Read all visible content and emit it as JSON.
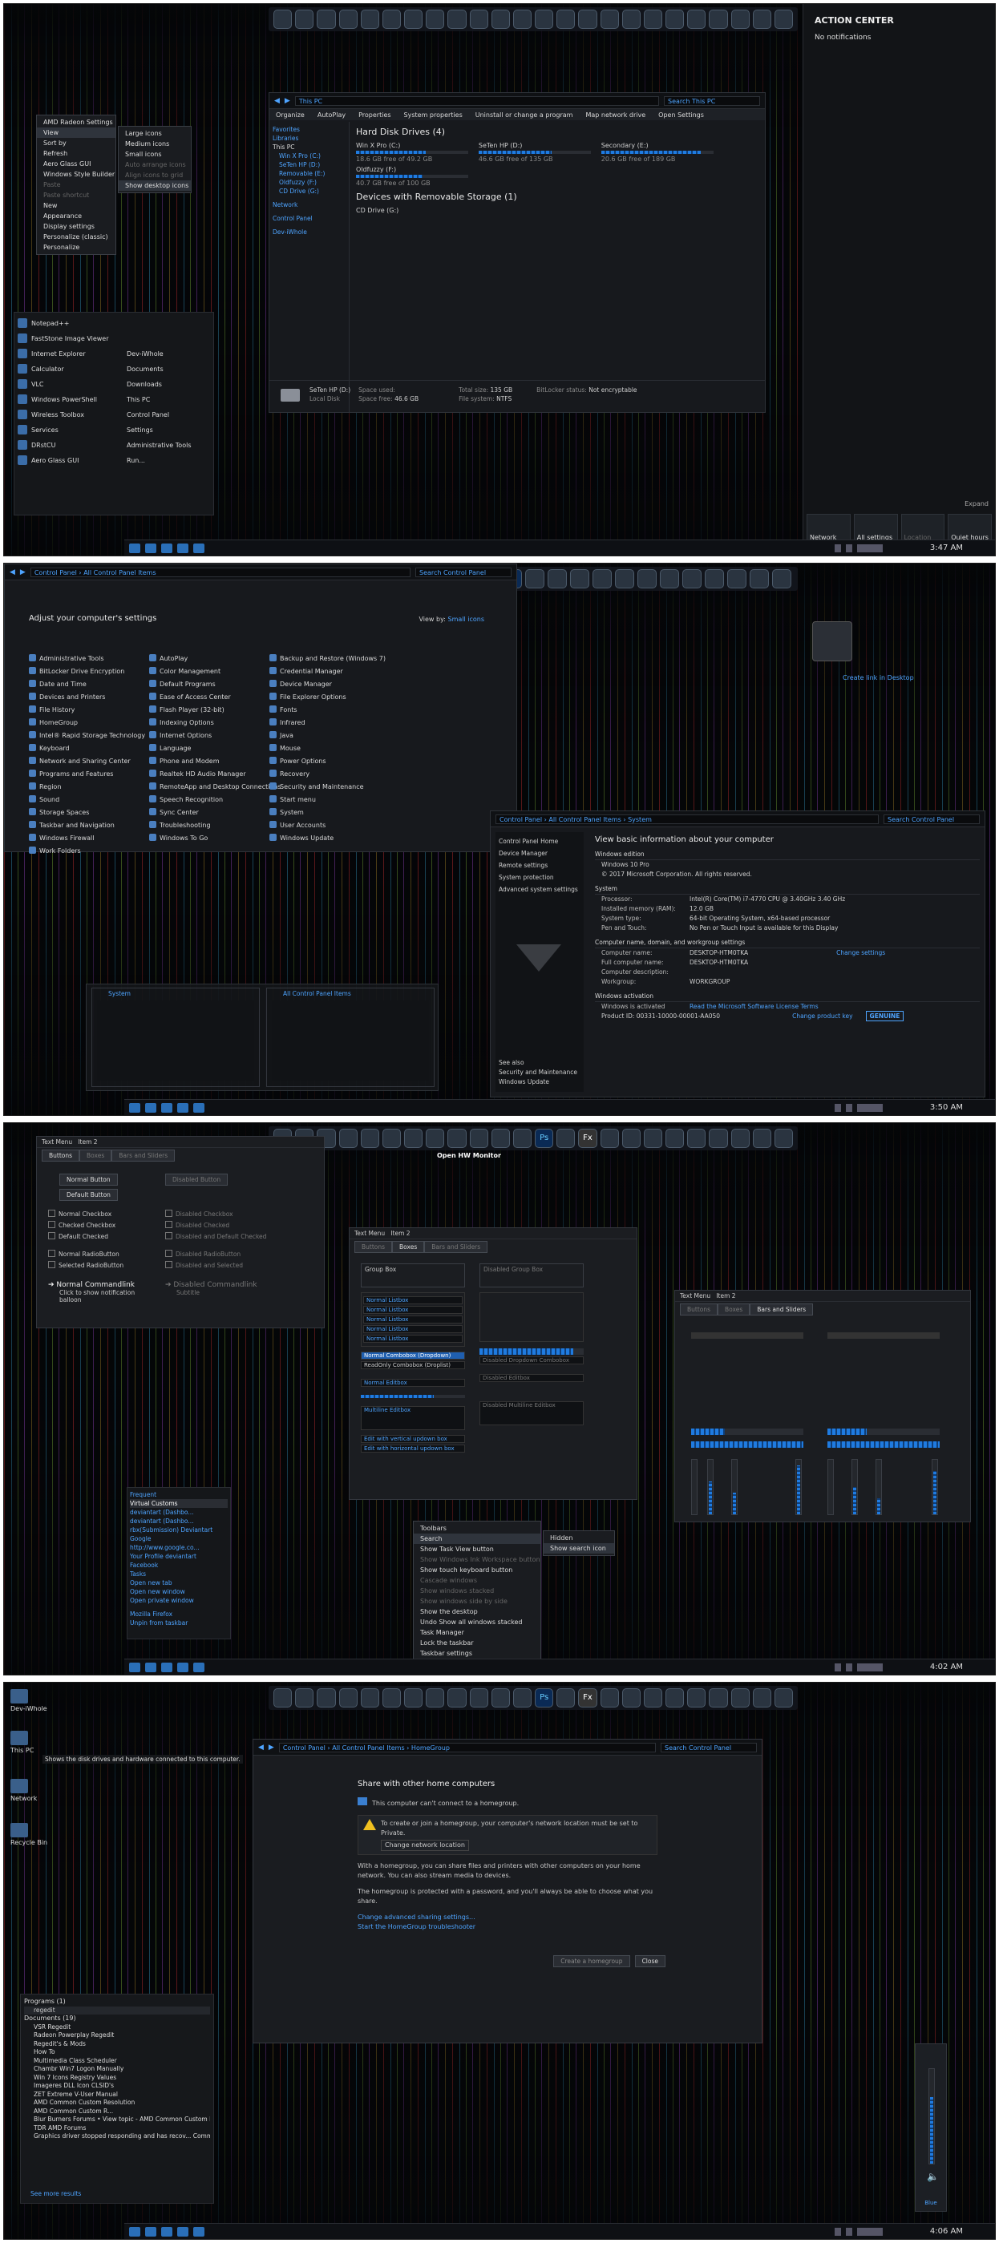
{
  "s1": {
    "menu": {
      "title": "AMD Radeon Settings",
      "items": [
        "View",
        "Sort by",
        "Refresh",
        "Aero Glass GUI",
        "Windows Style Builder",
        "Paste",
        "Paste shortcut",
        "New",
        "Appearance",
        "Display settings",
        "Personalize (classic)",
        "Personalize"
      ]
    },
    "viewmenu": [
      "Large icons",
      "Medium icons",
      "Small icons",
      "Auto arrange icons",
      "Align icons to grid",
      "Show desktop icons"
    ],
    "explorer": {
      "breadcrumb": "This PC",
      "search": "Search This PC",
      "cmds": [
        "Organize",
        "AutoPlay",
        "Properties",
        "System properties",
        "Uninstall or change a program",
        "Map network drive",
        "Open Settings"
      ],
      "side": [
        "Favorites",
        "Libraries",
        "This PC",
        "Win X Pro (C:)",
        "SeTen HP (D:)",
        "Removable (E:)",
        "Oldfuzzy (F:)",
        "CD Drive (G:)",
        "Network",
        "Control Panel",
        "Dev-iWhole"
      ],
      "hdd_title": "Hard Disk Drives (4)",
      "drives": [
        {
          "name": "Win X Pro (C:)",
          "free": "18.6 GB free of 49.2 GB",
          "pct": 62
        },
        {
          "name": "SeTen HP (D:)",
          "free": "46.6 GB free of 135 GB",
          "pct": 65
        },
        {
          "name": "Secondary (E:)",
          "free": "20.6 GB free of 189 GB",
          "pct": 89
        },
        {
          "name": "Oldfuzzy (F:)",
          "free": "40.7 GB free of 100 GB",
          "pct": 59
        }
      ],
      "rem_title": "Devices with Removable Storage (1)",
      "cd": "CD Drive (G:)",
      "status_name": "SeTen HP (D:)",
      "status_type": "Local Disk",
      "space_used_lbl": "Space used:",
      "space_free_lbl": "Space free:",
      "space_free": "46.6 GB",
      "total_lbl": "Total size:",
      "total": "135 GB",
      "fs_lbl": "File system:",
      "fs": "NTFS",
      "bl_lbl": "BitLocker status:",
      "bl": "Not encryptable"
    },
    "start": {
      "left": [
        "Notepad++",
        "FastStone Image Viewer",
        "Internet Explorer",
        "Calculator",
        "VLC",
        "Windows PowerShell",
        "Wireless Toolbox",
        "Services",
        "DRstCU",
        "Aero Glass GUI"
      ],
      "right": [
        "Dev-iWhole",
        "Documents",
        "Downloads",
        "This PC",
        "Control Panel",
        "Settings",
        "Administrative Tools",
        "Run..."
      ]
    },
    "ac": {
      "title": "ACTION CENTER",
      "none": "No notifications",
      "expand": "Expand",
      "btns": [
        "Network",
        "All settings",
        "Location",
        "Quiet hours"
      ]
    },
    "clock": "3:47 AM"
  },
  "s2": {
    "bc": [
      "Control Panel",
      "All Control Panel Items"
    ],
    "search": "Search Control Panel",
    "heading": "Adjust your computer's settings",
    "viewby_lbl": "View by:",
    "viewby": "Small icons",
    "items": [
      "Administrative Tools",
      "AutoPlay",
      "Backup and Restore (Windows 7)",
      "BitLocker Drive Encryption",
      "Color Management",
      "Credential Manager",
      "Date and Time",
      "Default Programs",
      "Device Manager",
      "Devices and Printers",
      "Ease of Access Center",
      "File Explorer Options",
      "File History",
      "Flash Player (32-bit)",
      "Fonts",
      "HomeGroup",
      "Indexing Options",
      "Infrared",
      "Intel® Rapid Storage Technology",
      "Internet Options",
      "Java",
      "Keyboard",
      "Language",
      "Mouse",
      "Network and Sharing Center",
      "Phone and Modem",
      "Power Options",
      "Programs and Features",
      "Realtek HD Audio Manager",
      "Recovery",
      "Region",
      "RemoteApp and Desktop Connections",
      "Security and Maintenance",
      "Sound",
      "Speech Recognition",
      "Start menu",
      "Storage Spaces",
      "Sync Center",
      "System",
      "Taskbar and Navigation",
      "Troubleshooting",
      "User Accounts",
      "Windows Firewall",
      "Windows To Go",
      "Windows Update",
      "Work Folders"
    ],
    "shortcut": "Create link in Desktop",
    "sys": {
      "bc": [
        "Control Panel",
        "All Control Panel Items",
        "System"
      ],
      "search": "Search Control Panel",
      "side": [
        "Control Panel Home",
        "Device Manager",
        "Remote settings",
        "System protection",
        "Advanced system settings"
      ],
      "seealso": [
        "See also",
        "Security and Maintenance",
        "Windows Update"
      ],
      "title": "View basic information about your computer",
      "edition_h": "Windows edition",
      "edition": "Windows 10 Pro",
      "copyright": "© 2017 Microsoft Corporation. All rights reserved.",
      "system_h": "System",
      "rows": [
        [
          "Processor:",
          "Intel(R) Core(TM) i7-4770 CPU @ 3.40GHz   3.40 GHz"
        ],
        [
          "Installed memory (RAM):",
          "12.0 GB"
        ],
        [
          "System type:",
          "64-bit Operating System, x64-based processor"
        ],
        [
          "Pen and Touch:",
          "No Pen or Touch Input is available for this Display"
        ]
      ],
      "name_h": "Computer name, domain, and workgroup settings",
      "rows2": [
        [
          "Computer name:",
          "DESKTOP-HTM0TKA"
        ],
        [
          "Full computer name:",
          "DESKTOP-HTM0TKA"
        ],
        [
          "Computer description:",
          ""
        ],
        [
          "Workgroup:",
          "WORKGROUP"
        ]
      ],
      "change": "Change settings",
      "act_h": "Windows activation",
      "act": "Windows is activated",
      "lic": "Read the Microsoft Software License Terms",
      "pid": "Product ID: 00331-10000-00001-AA050",
      "pkey": "Change product key",
      "genuine": "GENUINE"
    },
    "thumbs": [
      "System",
      "All Control Panel Items"
    ],
    "clock": "3:50 AM"
  },
  "s3": {
    "title": "Open HW Monitor",
    "cp1": {
      "tabs": [
        "Text Menu",
        "Item 2"
      ],
      "subtabs": [
        "Buttons",
        "Boxes",
        "Bars and Sliders"
      ],
      "btns": [
        "Normal Button",
        "Disabled Button",
        "Default Button"
      ],
      "checks": [
        "Normal Checkbox",
        "Checked Checkbox",
        "Default Checked",
        "Disabled Checkbox",
        "Disabled Checked",
        "Disabled and Default Checked"
      ],
      "radios": [
        "Normal RadioButton",
        "Selected RadioButton",
        "Disabled RadioButton",
        "Disabled and Selected"
      ],
      "cl_title": "Normal Commandlink",
      "cl_sub": "Click to show notification balloon",
      "cl_dis": "Disabled Commandlink",
      "cl_dis_sub": "Subtitle"
    },
    "cp2": {
      "tabs": [
        "Text Menu",
        "Item 2"
      ],
      "subtabs": [
        "Buttons",
        "Boxes",
        "Bars and Sliders"
      ],
      "g1": "Group Box",
      "g2": "Disabled Group Box",
      "lines": [
        "Normal Listbox",
        "Normal Listbox",
        "Normal Listbox",
        "Normal Listbox",
        "Normal Listbox"
      ],
      "combo": "Normal Combobox (Dropdown)",
      "combo2": "ReadOnly Combobox (Droplist)",
      "combo3": "Disabled Dropdown Combobox",
      "edit": "Normal Editbox",
      "edit2": "Disabled Editbox",
      "multi": "Multiline Editbox",
      "multi2": "Disabled Multiline Editbox",
      "spin1": "Edit with vertical updown box",
      "spin2": "Edit with horizontal updown box"
    },
    "cp3": {
      "tabs": [
        "Text Menu",
        "Item 2"
      ],
      "subtabs": [
        "Buttons",
        "Boxes",
        "Bars and Sliders"
      ]
    },
    "jump": {
      "frequent_h": "Frequent",
      "pin": "Virtual Customs",
      "items": [
        "deviantart (Dashbo...",
        "deviantart (Dashbo...",
        "rbx(Submission) Deviantart",
        "Google",
        "http://www.google.co...",
        "Your Profile deviantart",
        "Facebook"
      ],
      "tasks_h": "Tasks",
      "tasks": [
        "Open new tab",
        "Open new window",
        "Open private window"
      ],
      "app": "Mozilla Firefox",
      "unpin": "Unpin from taskbar"
    },
    "tbmenu": [
      "Toolbars",
      "Search",
      "Show Task View button",
      "Show Windows Ink Workspace button",
      "Show touch keyboard button",
      "Cascade windows",
      "Show windows stacked",
      "Show windows side by side",
      "Show the desktop",
      "Undo Show all windows stacked",
      "Task Manager",
      "Lock the taskbar",
      "Taskbar settings"
    ],
    "sub": [
      "Hidden",
      "Show search icon"
    ],
    "clock": "4:02 AM"
  },
  "s4": {
    "desk": [
      "Dev-iWhole",
      "This PC",
      "Network",
      "Recycle Bin"
    ],
    "tip": "Shows the disk drives and hardware connected to this computer.",
    "bc": [
      "Control Panel",
      "All Control Panel Items",
      "HomeGroup"
    ],
    "search": "Search Control Panel",
    "title": "Share with other home computers",
    "cant": "This computer can't connect to a homegroup.",
    "warn": "To create or join a homegroup, your computer's network location must be set to Private.",
    "warnlink": "Change network location",
    "p1": "With a homegroup, you can share files and printers with other computers on your home network. You can also stream media to devices.",
    "p2": "The homegroup is protected with a password, and you'll always be able to choose what you share.",
    "l1": "Change advanced sharing settings...",
    "l2": "Start the HomeGroup troubleshooter",
    "btn1": "Create a homegroup",
    "btn2": "Close",
    "results": {
      "prog_h": "Programs (1)",
      "prog": "regedit",
      "doc_h": "Documents (19)",
      "docs": [
        "VSR Regedit",
        "Radeon Powerplay Regedit",
        "Regedit's & Mods",
        "How To",
        "Multimedia Class Scheduler",
        "Chambr Win7 Logon Manually",
        "Win 7 Icons Registry Values",
        "Imageres DLL Icon CLSID's",
        "ZET Extreme V-User Manual",
        "AMD Common Custom Resolution",
        "AMD Common Custom R...",
        "Blur Burners Forums • View topic - AMD Common Custom R...",
        "TDR AMD Forums",
        "Graphics driver stopped responding and has recov...  Comm..."
      ],
      "more": "See more results"
    },
    "vol": "Blue",
    "clock": "4:06 AM"
  }
}
